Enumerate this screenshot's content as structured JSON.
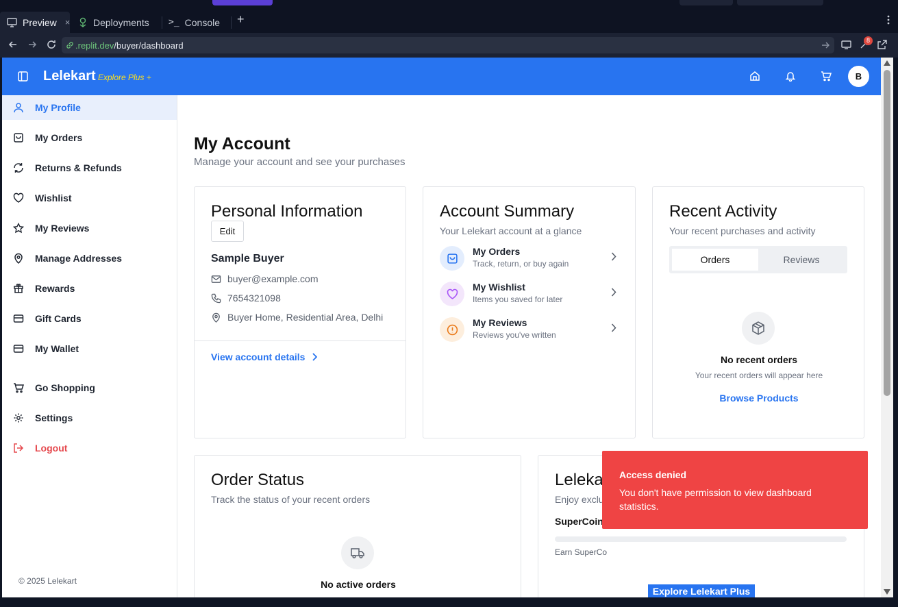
{
  "browser": {
    "tabs": [
      {
        "label": "Preview",
        "close": "×"
      },
      {
        "label": "Deployments"
      },
      {
        "label": "Console"
      }
    ],
    "new_tab": "+",
    "url_host": ".replit.dev",
    "url_path": "/buyer/dashboard",
    "notification_count": "8"
  },
  "header": {
    "brand": "Lelekart",
    "brand_sub": "Explore Plus +",
    "avatar_initial": "B",
    "colors": {
      "primary": "#2874f0",
      "accent": "#ffe11b"
    }
  },
  "sidebar": {
    "items": [
      {
        "label": "My Profile",
        "icon": "user-icon"
      },
      {
        "label": "My Orders",
        "icon": "shopping-bag-icon"
      },
      {
        "label": "Returns & Refunds",
        "icon": "refresh-icon"
      },
      {
        "label": "Wishlist",
        "icon": "heart-icon"
      },
      {
        "label": "My Reviews",
        "icon": "star-icon"
      },
      {
        "label": "Manage Addresses",
        "icon": "map-pin-icon"
      },
      {
        "label": "Rewards",
        "icon": "gift-icon"
      },
      {
        "label": "Gift Cards",
        "icon": "credit-card-icon"
      },
      {
        "label": "My Wallet",
        "icon": "wallet-icon"
      },
      {
        "label": "Go Shopping",
        "icon": "cart-icon"
      },
      {
        "label": "Settings",
        "icon": "gear-icon"
      },
      {
        "label": "Logout",
        "icon": "logout-icon"
      }
    ],
    "copyright": "© 2025 Lelekart"
  },
  "main": {
    "title": "My Account",
    "subtitle": "Manage your account and see your purchases",
    "personal": {
      "title": "Personal Information",
      "edit_label": "Edit",
      "name": "Sample Buyer",
      "email": "buyer@example.com",
      "phone": "7654321098",
      "address": "Buyer Home, Residential Area, Delhi",
      "link": "View account details"
    },
    "summary": {
      "title": "Account Summary",
      "subtitle": "Your Lelekart account at a glance",
      "rows": [
        {
          "title": "My Orders",
          "desc": "Track, return, or buy again"
        },
        {
          "title": "My Wishlist",
          "desc": "Items you saved for later"
        },
        {
          "title": "My Reviews",
          "desc": "Reviews you've written"
        }
      ]
    },
    "activity": {
      "title": "Recent Activity",
      "subtitle": "Your recent purchases and activity",
      "tabs": [
        "Orders",
        "Reviews"
      ],
      "empty_title": "No recent orders",
      "empty_sub": "Your recent orders will appear here",
      "browse": "Browse Products"
    },
    "order_status": {
      "title": "Order Status",
      "subtitle": "Track the status of your recent orders",
      "empty_title": "No active orders"
    },
    "plus": {
      "title": "Lelekart Plus",
      "subtitle": "Enjoy exclusive benefits with Lelekart Plus",
      "supercoins_label": "SuperCoins",
      "supercoins_desc": "Earn SuperCo",
      "cta": "Explore Lelekart Plus"
    }
  },
  "toast": {
    "title": "Access denied",
    "message": "You don't have permission to view dashboard statistics.",
    "color": "#ef4444"
  }
}
